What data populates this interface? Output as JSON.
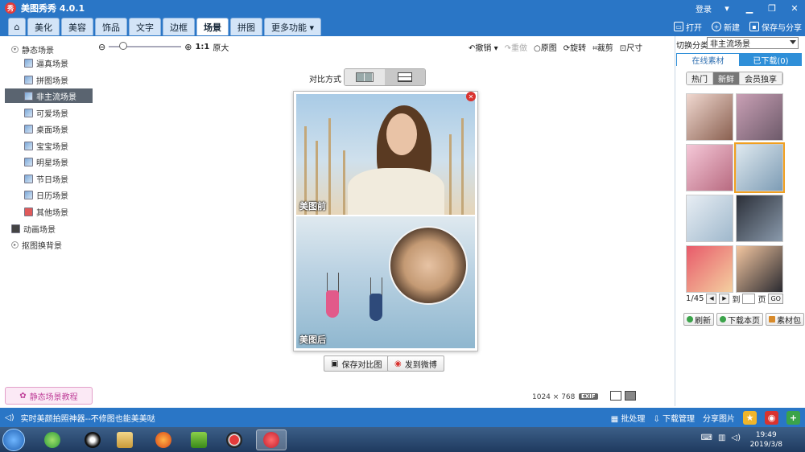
{
  "app": {
    "title": "美图秀秀 4.0.1",
    "login": "登录",
    "logo_glyph": "秀"
  },
  "window": {
    "minimize_glyph": "▁",
    "maximize_glyph": "❐",
    "close_glyph": "✕"
  },
  "tabs": [
    {
      "id": "home",
      "label": "⌂"
    },
    {
      "id": "beautify",
      "label": "美化"
    },
    {
      "id": "face",
      "label": "美容"
    },
    {
      "id": "accessory",
      "label": "饰品"
    },
    {
      "id": "text",
      "label": "文字"
    },
    {
      "id": "border",
      "label": "边框"
    },
    {
      "id": "scene",
      "label": "场景"
    },
    {
      "id": "collage",
      "label": "拼图"
    },
    {
      "id": "more",
      "label": "更多功能 ▾"
    }
  ],
  "top_actions": {
    "open": "打开",
    "new": "新建",
    "save_share": "保存与分享"
  },
  "sidebar": {
    "static_group": "静态场景",
    "items": [
      "逼真场景",
      "拼图场景",
      "非主流场景",
      "可爱场景",
      "桌面场景",
      "宝宝场景",
      "明星场景",
      "节日场景",
      "日历场景",
      "其他场景"
    ],
    "anim_group": "动画场景",
    "cutout_group": "抠图换背景",
    "tutorial": "静态场景教程"
  },
  "zoom": {
    "ratio": "1:1",
    "enlarge": "原大",
    "level": 0.16
  },
  "edit_tools": {
    "undo": "撤销",
    "redo": "重做",
    "original": "原图",
    "rotate": "旋转",
    "crop": "裁剪",
    "size": "尺寸"
  },
  "compare": {
    "label": "对比方式",
    "before": "美图前",
    "after": "美图后"
  },
  "buttons": {
    "save_compare": "保存对比图",
    "post_weibo": "发到微博"
  },
  "image_info": {
    "width": "1024",
    "times": "×",
    "height": "768",
    "exif": "EXIF"
  },
  "right_panel": {
    "category_label": "切换分类",
    "category_value": "非主流场景",
    "tab_online": "在线素材",
    "tab_downloaded": "已下载(0)",
    "subtabs": [
      "热门",
      "新鲜",
      "会员独享"
    ],
    "pager": {
      "page": "1/45",
      "to": "到",
      "page_unit": "页",
      "go": "GO"
    },
    "refresh": "刷新",
    "download_page": "下载本页",
    "material_pack": "素材包"
  },
  "status": {
    "message": "实时美颜拍照神器--不修图也能美美哒",
    "batch": "批处理",
    "download_mgr": "下载管理",
    "share_pic": "分享图片"
  },
  "taskbar": {
    "time": "19:49",
    "date": "2019/3/8"
  },
  "colors": {
    "titlebar": "#2a76c6",
    "accent_orange": "#f0a020",
    "close_red": "#d9332f"
  }
}
